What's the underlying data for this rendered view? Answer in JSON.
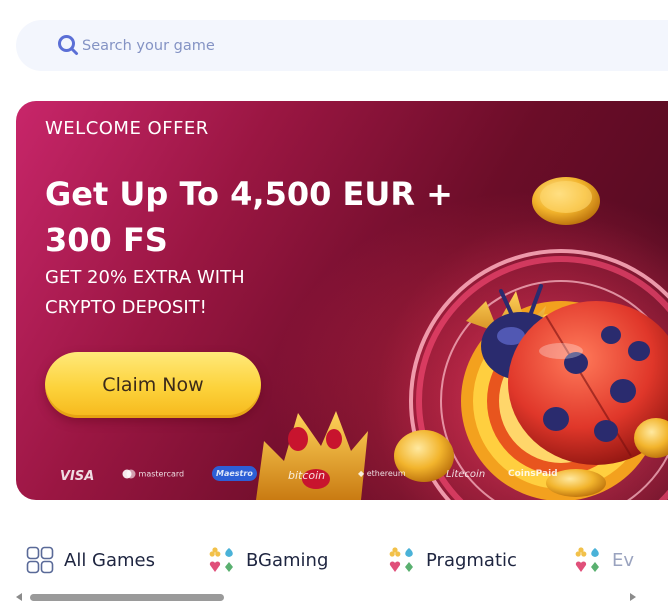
{
  "search": {
    "placeholder": "Search your game",
    "icon": "search-icon"
  },
  "banner": {
    "label": "WELCOME OFFER",
    "title": "Get Up To 4,500 EUR + 300 FS",
    "subtitle": "GET 20% EXTRA WITH CRYPTO DEPOSIT!",
    "cta": "Claim Now",
    "payments": [
      "VISA",
      "mastercard",
      "Maestro",
      "bitcoin",
      "ethereum",
      "Litecoin",
      "CoinsPaid"
    ]
  },
  "providers": [
    {
      "label": "All Games",
      "icon": "grid-icon"
    },
    {
      "label": "BGaming",
      "icon": "card-suits-icon"
    },
    {
      "label": "Pragmatic",
      "icon": "card-suits-icon"
    },
    {
      "label": "Ev",
      "icon": "card-suits-icon"
    }
  ],
  "colors": {
    "accent_yellow": "#fcd23a",
    "banner_dark": "#6b0d28",
    "banner_pink": "#c8266a",
    "search_bg": "#f3f6fd",
    "search_icon": "#5b6fd6"
  }
}
